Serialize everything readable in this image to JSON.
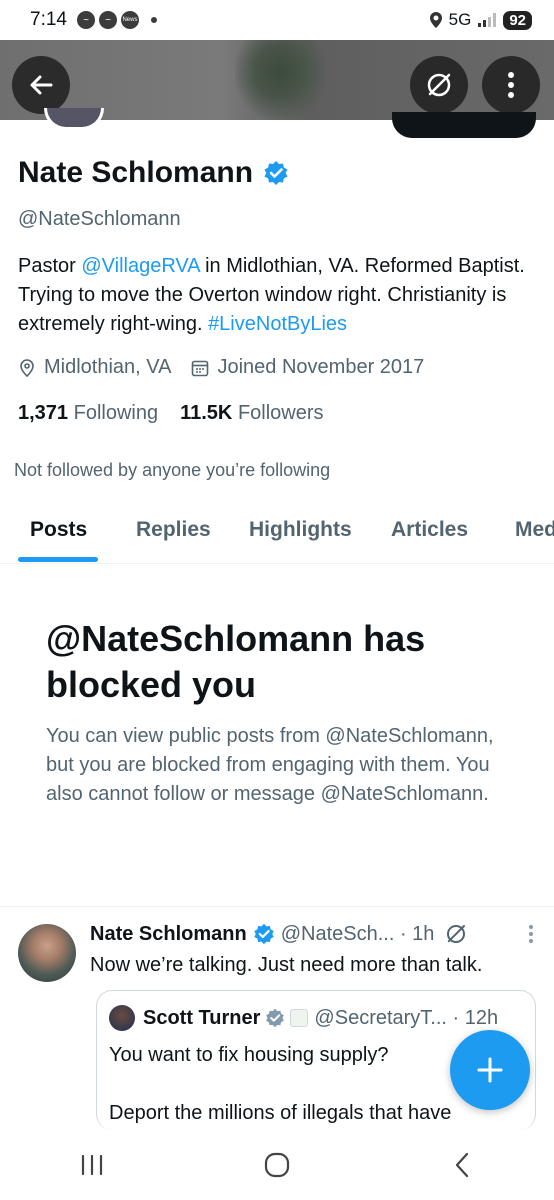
{
  "status_bar": {
    "time": "7:14",
    "news_label": "News",
    "network": "5G",
    "battery": "92"
  },
  "header": {
    "back_icon": "back-arrow-icon",
    "grok_icon": "grok-icon",
    "more_icon": "more-vertical-icon"
  },
  "profile": {
    "name": "Nate Schlomann",
    "handle": "@NateSchlomann",
    "bio": {
      "p1": "Pastor ",
      "mention": "@VillageRVA",
      "p2": " in Midlothian, VA. Reformed Baptist. Trying to move the Overton window right. Christianity is extremely right-wing. ",
      "hashtag": "#LiveNotByLies"
    },
    "location": "Midlothian, VA",
    "joined": "Joined November 2017",
    "following_count": "1,371",
    "following_label": "Following",
    "followers_count": "11.5K",
    "followers_label": "Followers",
    "not_followed": "Not followed by anyone you’re following"
  },
  "tabs": [
    {
      "label": "Posts"
    },
    {
      "label": "Replies"
    },
    {
      "label": "Highlights"
    },
    {
      "label": "Articles"
    },
    {
      "label": "Med"
    }
  ],
  "blocked": {
    "title": "@NateSchlomann has blocked you",
    "body": "You can view public posts from @NateSchlomann, but you are blocked from engaging with them. You also cannot follow or message @NateSchlomann."
  },
  "post": {
    "name": "Nate Schlomann",
    "handle_time": "@NateSch... · 1h",
    "text": "Now we’re talking. Just need more than talk.",
    "quote": {
      "name": "Scott Turner",
      "handle_time": "@SecretaryT... · 12h",
      "line1": "You want to fix housing supply?",
      "line2": "Deport the millions of illegals that have"
    }
  },
  "colors": {
    "accent": "#1d9bf0",
    "text": "#0f1419",
    "secondary": "#536471"
  }
}
